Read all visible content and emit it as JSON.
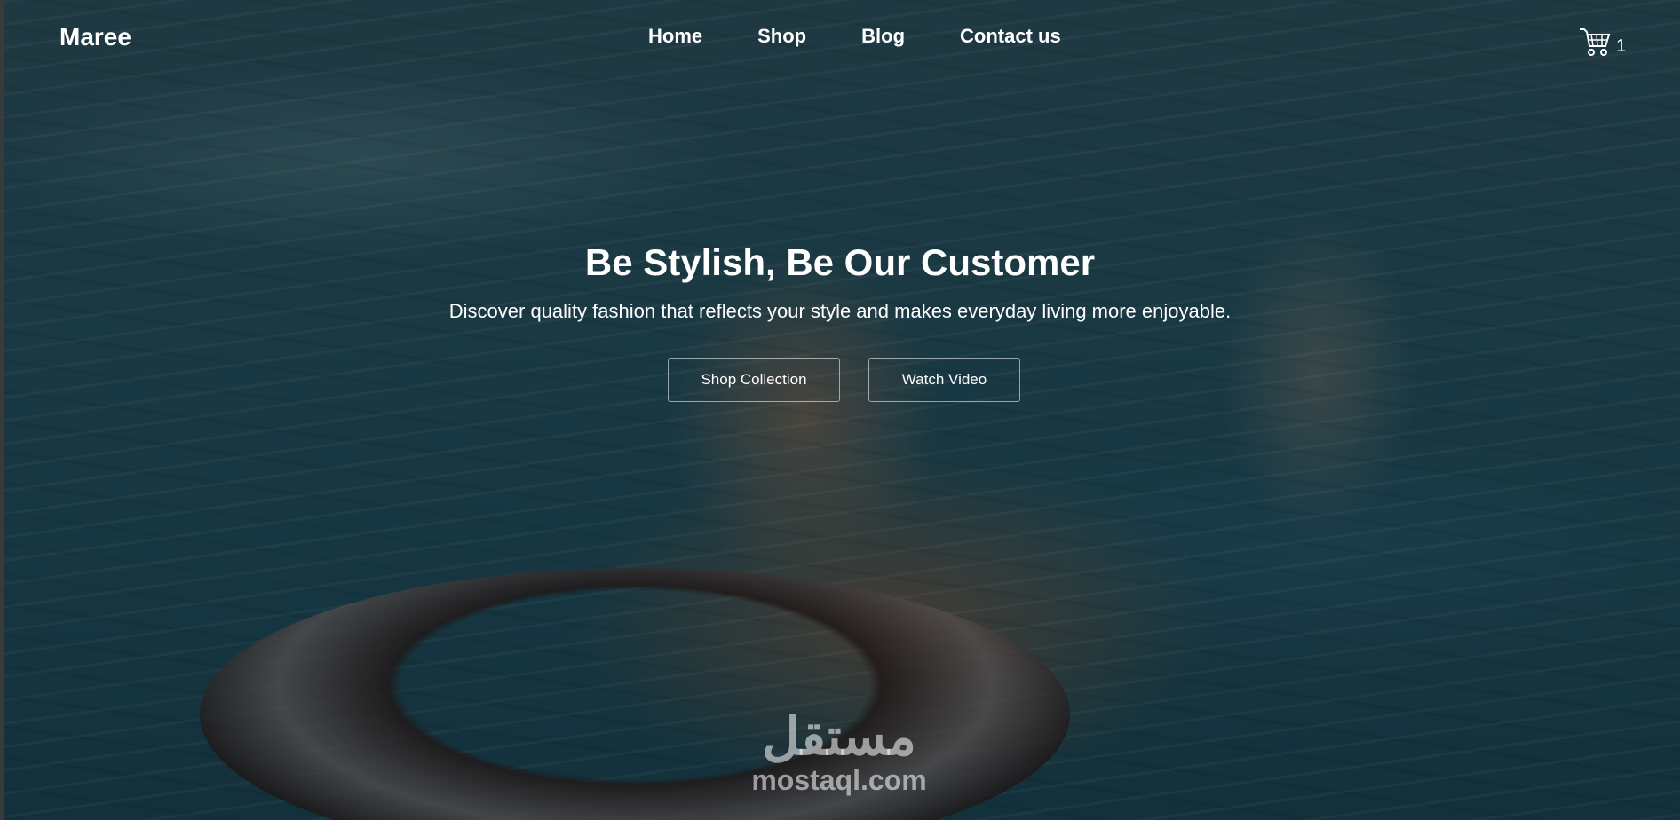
{
  "brand": {
    "name": "Maree"
  },
  "nav": {
    "items": [
      {
        "label": "Home"
      },
      {
        "label": "Shop"
      },
      {
        "label": "Blog"
      },
      {
        "label": "Contact us"
      }
    ]
  },
  "cart": {
    "icon": "cart-icon",
    "count": "1"
  },
  "hero": {
    "title": "Be Stylish, Be Our Customer",
    "subtitle": "Discover quality fashion that reflects your style and makes everyday living more enjoyable.",
    "primary_button": "Shop Collection",
    "secondary_button": "Watch Video"
  },
  "watermark": {
    "arabic": "مستقل",
    "latin": "mostaql.com"
  },
  "colors": {
    "text": "#ffffff",
    "water": "#1f4d5c"
  }
}
